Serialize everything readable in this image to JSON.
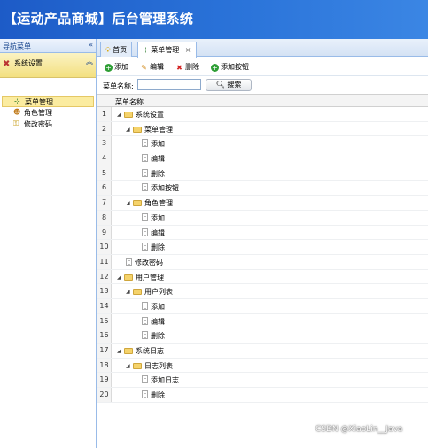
{
  "header": {
    "title": "【运动产品商城】后台管理系统"
  },
  "nav": {
    "title": "导航菜单",
    "section": "系统设置",
    "items": [
      {
        "label": "菜单管理",
        "icon": "sitemap-icon",
        "selected": true
      },
      {
        "label": "角色管理",
        "icon": "users-icon",
        "selected": false
      },
      {
        "label": "修改密码",
        "icon": "key-icon",
        "selected": false
      }
    ]
  },
  "tabs": [
    {
      "label": "首页",
      "icon": "lightbulb-icon"
    },
    {
      "label": "菜单管理",
      "icon": "sitemap-icon",
      "closable": true
    }
  ],
  "toolbar": {
    "add": "添加",
    "edit": "编辑",
    "delete": "删除",
    "add_button": "添加按钮"
  },
  "search": {
    "label": "菜单名称:",
    "value": "",
    "button": "搜索"
  },
  "grid": {
    "column": "菜单名称",
    "rows": [
      {
        "num": "1",
        "label": "系统设置",
        "level": 0,
        "type": "folder"
      },
      {
        "num": "2",
        "label": "菜单管理",
        "level": 1,
        "type": "folder"
      },
      {
        "num": "3",
        "label": "添加",
        "level": 2,
        "type": "file"
      },
      {
        "num": "4",
        "label": "编辑",
        "level": 2,
        "type": "file"
      },
      {
        "num": "5",
        "label": "删除",
        "level": 2,
        "type": "file"
      },
      {
        "num": "6",
        "label": "添加按钮",
        "level": 2,
        "type": "file"
      },
      {
        "num": "7",
        "label": "角色管理",
        "level": 1,
        "type": "folder"
      },
      {
        "num": "8",
        "label": "添加",
        "level": 2,
        "type": "file"
      },
      {
        "num": "9",
        "label": "编辑",
        "level": 2,
        "type": "file"
      },
      {
        "num": "10",
        "label": "删除",
        "level": 2,
        "type": "file"
      },
      {
        "num": "11",
        "label": "修改密码",
        "level": 1,
        "type": "file"
      },
      {
        "num": "12",
        "label": "用户管理",
        "level": 0,
        "type": "folder"
      },
      {
        "num": "13",
        "label": "用户列表",
        "level": 1,
        "type": "folder"
      },
      {
        "num": "14",
        "label": "添加",
        "level": 2,
        "type": "file"
      },
      {
        "num": "15",
        "label": "编辑",
        "level": 2,
        "type": "file"
      },
      {
        "num": "16",
        "label": "删除",
        "level": 2,
        "type": "file"
      },
      {
        "num": "17",
        "label": "系统日志",
        "level": 0,
        "type": "folder"
      },
      {
        "num": "18",
        "label": "日志列表",
        "level": 1,
        "type": "folder"
      },
      {
        "num": "19",
        "label": "添加日志",
        "level": 2,
        "type": "file"
      },
      {
        "num": "20",
        "label": "删除",
        "level": 2,
        "type": "file"
      }
    ]
  },
  "watermark": "CSDN @XiaoLin__Java"
}
